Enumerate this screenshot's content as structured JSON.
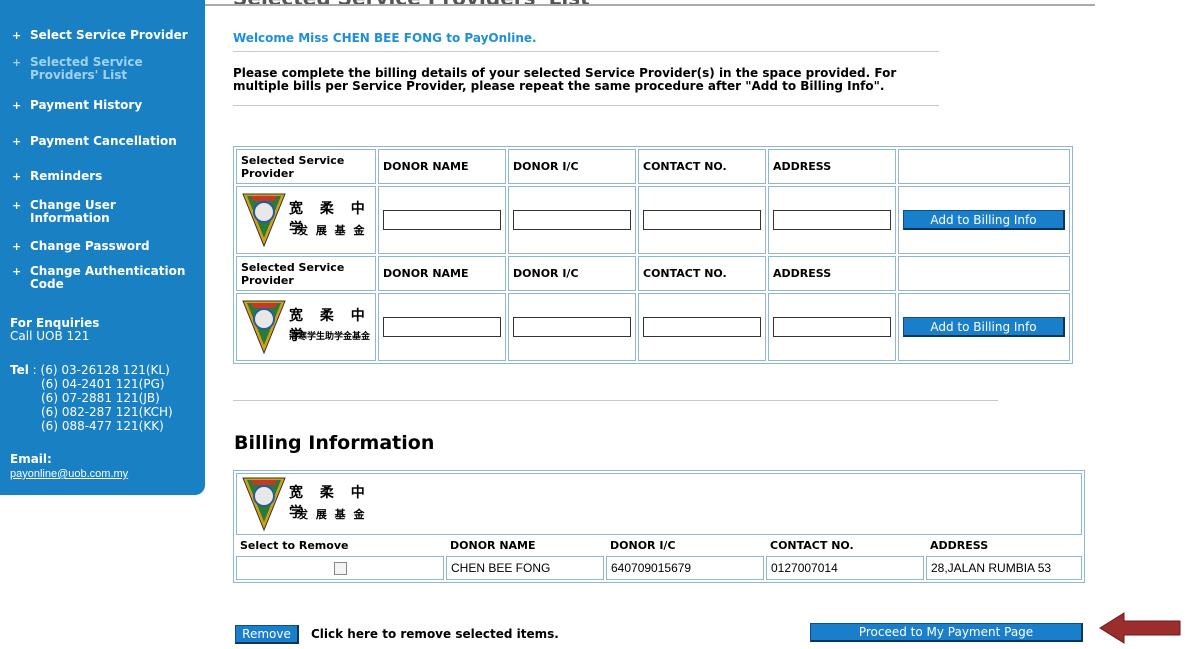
{
  "page": {
    "title_top": "Selected Service Providers' List"
  },
  "sidebar": {
    "items": [
      {
        "label": "Select Service Provider"
      },
      {
        "label": "Selected Service Providers' List"
      },
      {
        "label": "Payment History"
      },
      {
        "label": "Payment Cancellation"
      },
      {
        "label": "Reminders"
      },
      {
        "label": "Change User Information"
      },
      {
        "label": "Change Password"
      },
      {
        "label": "Change Authentication Code"
      }
    ],
    "enquiries_title": "For Enquiries",
    "enquiries_call": "Call UOB 121",
    "tel_label": "Tel",
    "tel_numbers": [
      ": (6) 03-26128 121(KL)",
      "(6) 04-2401 121(PG)",
      "(6) 07-2881 121(JB)",
      "(6) 082-287 121(KCH)",
      "(6) 088-477 121(KK)"
    ],
    "email_label": "Email:",
    "email": "payonline@uob.com.my"
  },
  "welcome": "Welcome Miss CHEN BEE FONG to PayOnline.",
  "instructions": "Please complete the billing details of your selected Service Provider(s) in the space provided. For multiple bills per Service Provider, please repeat the same procedure after \"Add to Billing Info\".",
  "providers_table": {
    "headers": [
      "Selected Service Provider",
      "DONOR NAME",
      "DONOR I/C",
      "CONTACT NO.",
      "ADDRESS"
    ],
    "add_button": "Add to Billing Info",
    "rows": [
      {
        "logo_chars": "宽 柔 中 学",
        "logo_sub": "发 展 基 金"
      },
      {
        "logo_chars": "宽 柔 中 学",
        "logo_sub": "清寒学生助学金基金"
      }
    ]
  },
  "billing": {
    "title": "Billing Information",
    "logo_chars": "宽 柔 中 学",
    "logo_sub": "发 展 基 金",
    "headers": [
      "Select to Remove",
      "DONOR NAME",
      "DONOR I/C",
      "CONTACT NO.",
      "ADDRESS"
    ],
    "rows": [
      {
        "name": "CHEN BEE FONG",
        "ic": "640709015679",
        "contact": "0127007014",
        "address": "28,JALAN RUMBIA 53"
      }
    ]
  },
  "actions": {
    "remove_button": "Remove",
    "remove_note": "Click here to remove selected items.",
    "proceed_button": "Proceed to My Payment Page"
  },
  "colors": {
    "sidebar_bg": "#1a80c4",
    "welcome_text": "#1e90d8",
    "button_bg": "#1a7fca",
    "table_border": "#8fb6d6",
    "arrow": "#9b2d2d"
  }
}
